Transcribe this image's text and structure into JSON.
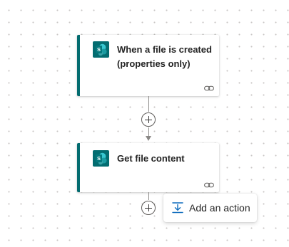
{
  "flow": {
    "steps": [
      {
        "title": "When a file is created (properties only)",
        "icon": "sharepoint-icon",
        "footer_icon": "link-icon"
      },
      {
        "title": "Get file content",
        "icon": "sharepoint-icon",
        "footer_icon": "link-icon"
      }
    ],
    "insert_button_icon": "plus-icon",
    "add_action": {
      "label": "Add an action",
      "icon": "insert-action-icon"
    }
  },
  "colors": {
    "accent": "#036c70",
    "action_blue": "#0f6cbd",
    "connector": "#8a8886",
    "text": "#242424"
  }
}
